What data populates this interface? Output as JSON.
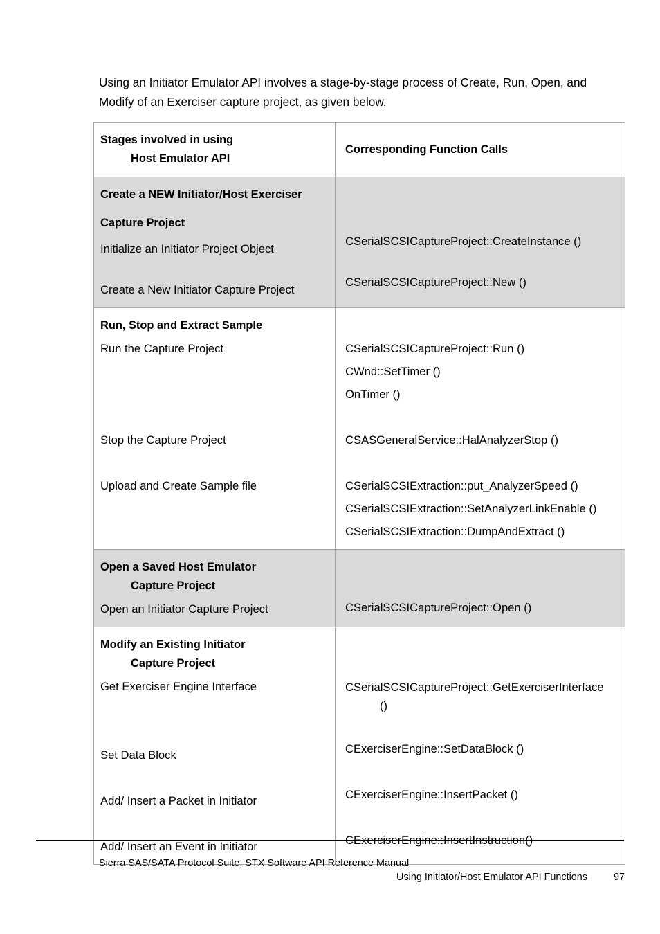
{
  "document": {
    "intro_paragraph": "Using an Initiator Emulator API involves a stage-by-stage process of Create, Run, Open, and Modify of an Exerciser capture project, as given below."
  },
  "table": {
    "header": {
      "col1_line1": "Stages involved in using",
      "col1_line2": "Host Emulator API",
      "col2": "Corresponding Function Calls"
    },
    "rows": [
      {
        "shaded": true,
        "stage_title_line1": "Create a NEW Initiator/Host Exerciser",
        "stage_title_line2": "Capture Project",
        "stage_item_1": "Initialize an Initiator Project Object",
        "stage_item_2": "Create a New Initiator Capture Project",
        "fn_1": "CSerialSCSICaptureProject::CreateInstance ()",
        "fn_2": "CSerialSCSICaptureProject::New ()"
      },
      {
        "shaded": false,
        "stage_title_line1": "Run, Stop and Extract Sample",
        "stage_item_1": "Run the Capture Project",
        "stage_item_2": "Stop the Capture Project",
        "stage_item_3": "Upload and Create Sample file",
        "fn_1a": "CSerialSCSICaptureProject::Run ()",
        "fn_1b": "CWnd::SetTimer ()",
        "fn_1c": "OnTimer ()",
        "fn_2": "CSASGeneralService::HalAnalyzerStop ()",
        "fn_3a": "CSerialSCSIExtraction::put_AnalyzerSpeed ()",
        "fn_3b": "CSerialSCSIExtraction::SetAnalyzerLinkEnable ()",
        "fn_3c": "CSerialSCSIExtraction::DumpAndExtract ()"
      },
      {
        "shaded": true,
        "stage_title_line1": "Open a Saved Host Emulator",
        "stage_title_line2": "Capture Project",
        "stage_item_1": "Open an Initiator Capture Project",
        "fn_1": "CSerialSCSICaptureProject::Open ()"
      },
      {
        "shaded": false,
        "stage_title_line1": "Modify an Existing Initiator",
        "stage_title_line2": "Capture Project",
        "stage_item_1": "Get Exerciser Engine Interface",
        "stage_item_2": "Set Data Block",
        "stage_item_3": "Add/ Insert a Packet in Initiator",
        "stage_item_4": "Add/ Insert an Event in Initiator",
        "fn_1a": "CSerialSCSICaptureProject::GetExerciserInterface",
        "fn_1b": "()",
        "fn_2": "CExerciserEngine::SetDataBlock ()",
        "fn_3": "CExerciserEngine::InsertPacket ()",
        "fn_4": "CExerciserEngine::InsertInstruction()"
      }
    ]
  },
  "footer": {
    "manual_title": "Sierra SAS/SATA Protocol Suite, STX Software API Reference Manual",
    "section_title": "Using Initiator/Host Emulator API Functions",
    "page_number": "97"
  }
}
